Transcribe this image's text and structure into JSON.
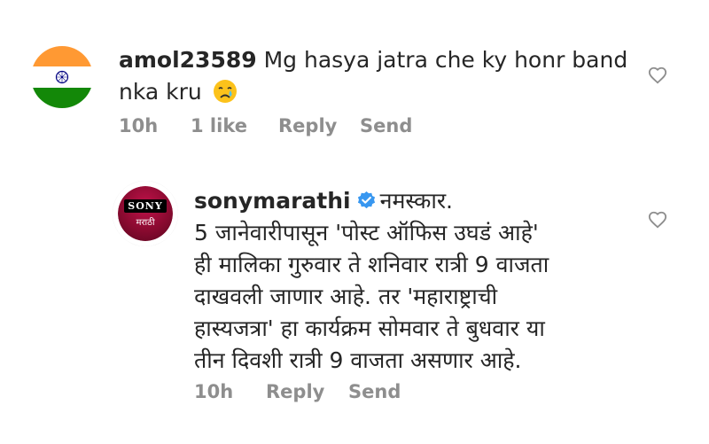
{
  "comments": [
    {
      "username": "amol23589",
      "text": "Mg hasya jatra che ky honr band",
      "text_line2": "nka kru",
      "emoji_icon": "crying-face-emoji",
      "time": "10h",
      "likes": "1 like",
      "reply_label": "Reply",
      "send_label": "Send",
      "avatar_icon": "india-flag-icon"
    },
    {
      "username": "sonymarathi",
      "verified_icon": "verified-badge-icon",
      "lines": [
        "नमस्कार.",
        "5 जानेवारीपासून 'पोस्ट ऑफिस उघडं आहे'",
        "ही मालिका गुरुवार ते शनिवार रात्री 9 वाजता",
        "दाखवली जाणार आहे. तर 'महाराष्ट्राची",
        "हास्यजत्रा' हा कार्यक्रम सोमवार ते बुधवार या",
        "तीन दिवशी रात्री 9 वाजता असणार आहे."
      ],
      "time": "10h",
      "reply_label": "Reply",
      "send_label": "Send",
      "avatar_brand": "SONY",
      "avatar_sub": "मराठी"
    }
  ],
  "colors": {
    "text": "#262626",
    "meta": "#8e8e8e",
    "verified": "#3897f0",
    "sony_red": "#a0103c"
  }
}
